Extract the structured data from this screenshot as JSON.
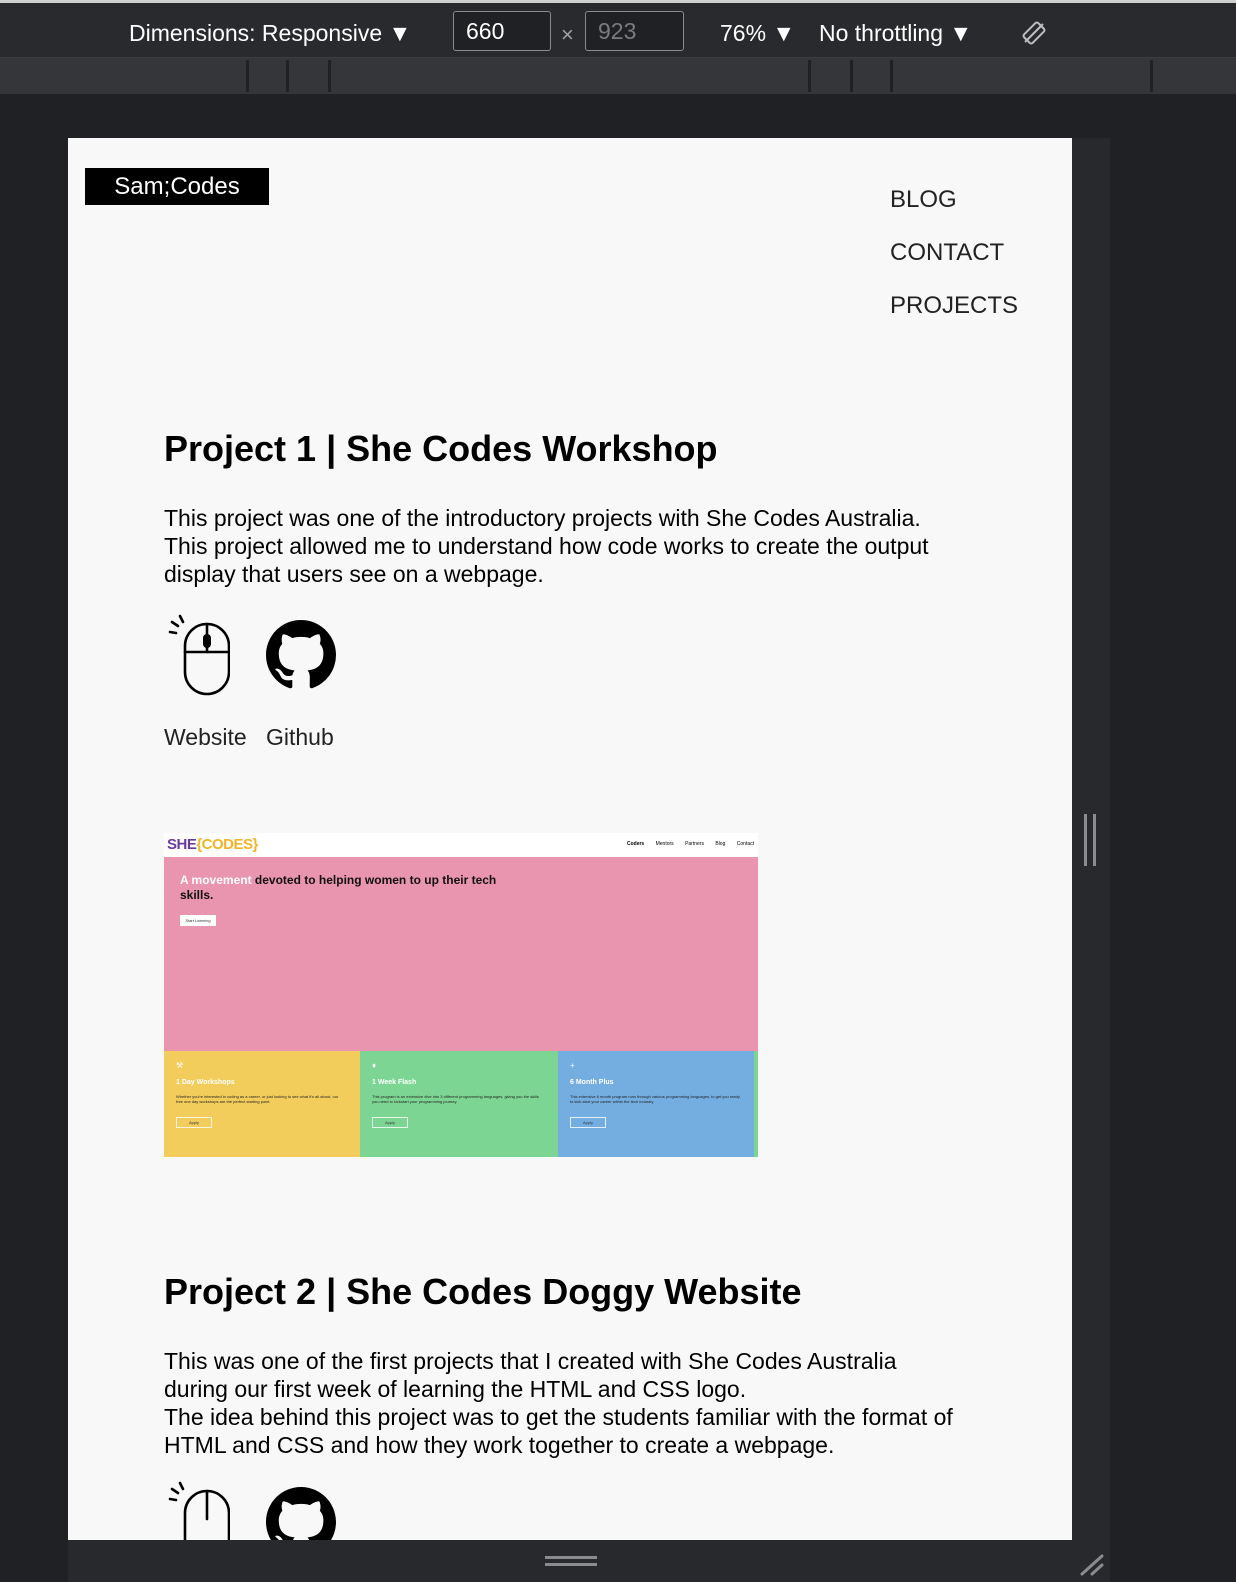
{
  "devtools": {
    "dimensions_label": "Dimensions: Responsive ▼",
    "width_value": "660",
    "height_placeholder": "923",
    "times": "×",
    "zoom_label": "76% ▼",
    "throttle_label": "No throttling ▼",
    "rotate_icon": "rotate-icon"
  },
  "site": {
    "logo": "Sam;Codes",
    "nav": [
      "BLOG",
      "CONTACT",
      "PROJECTS"
    ],
    "projects": [
      {
        "title": "Project 1 | She Codes Workshop",
        "description": "This project was one of the introductory projects with She Codes Australia.\nThis project allowed me to understand how code works to create the output display that users see on a webpage.",
        "links": [
          {
            "label": "Website",
            "icon": "mouse-click-icon"
          },
          {
            "label": "Github",
            "icon": "github-icon"
          }
        ]
      },
      {
        "title": "Project 2 | She Codes Doggy Website",
        "description": "This was one of the first projects that I created with She Codes Australia during our first week of learning the HTML and CSS logo.\nThe idea behind this project was to get the students familiar with the format of HTML and CSS and how they work together to create a webpage."
      }
    ],
    "screenshot": {
      "logo_a": "SHE",
      "logo_b": "{CODES}",
      "nav": [
        "Coders",
        "Mentors",
        "Partners",
        "Blog",
        "Contact"
      ],
      "hero_highlight": "A movement",
      "hero_text": " devoted to helping women to up their tech skills.",
      "hero_button": "Start Learning",
      "cards": [
        {
          "icon": "⚒",
          "title": "1 Day Workshops",
          "body": "Whether you're interested in coding as a career, or just looking to see what it's all about, our free one day workshops are the perfect starting point.",
          "button": "Apply",
          "color": "#f2cd5c"
        },
        {
          "icon": "♦",
          "title": "1 Week Flash",
          "body": "This program is an extensive dive into 3 different programming languages, giving you the skills you need to kickstart your programming journey.",
          "button": "Apply",
          "color": "#7dd593"
        },
        {
          "icon": "+",
          "title": "6 Month Plus",
          "body": "This extensive 6 month program runs through various programming languages, to get you ready to kick start your career within the tech industry.",
          "button": "Apply",
          "color": "#74ade0"
        }
      ]
    }
  },
  "colors": {
    "devtools_bg": "#202124",
    "toolbar_bg": "#292a2d",
    "page_bg": "#f8f8f8",
    "hero_pink": "#e995b0"
  }
}
